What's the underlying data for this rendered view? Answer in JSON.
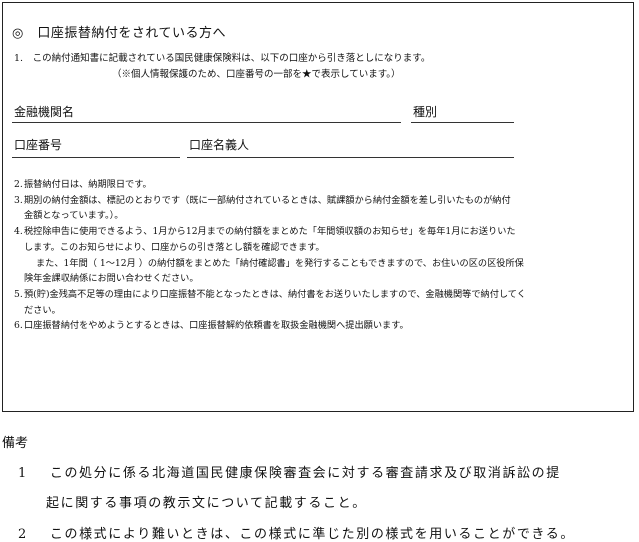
{
  "form": {
    "title": "◎　口座振替納付をされている方へ",
    "item1": "1.　この納付通知書に記載されている国民健康保険料は、以下の口座から引き落としになります。",
    "item1_note": "（※個人情報保護のため、口座番号の一部を★で表示しています。）",
    "fields": {
      "bank_label": "金融機関名",
      "type_label": "種別",
      "account_no_label": "口座番号",
      "holder_label": "口座名義人"
    },
    "notes": [
      {
        "num": "2.",
        "lines": [
          "振替納付日は、納期限日です。"
        ]
      },
      {
        "num": "3.",
        "lines": [
          "期別の納付金額は、標記のとおりです（既に一部納付されているときは、賦課額から納付金額を差し引いたものが納付",
          "金額となっています。）。"
        ]
      },
      {
        "num": "4.",
        "lines": [
          "税控除申告に使用できるよう、1月から12月までの納付額をまとめた「年間領収額のお知らせ」を毎年1月にお送りいた",
          "します。このお知らせにより、口座からの引き落とし額を確認できます。"
        ],
        "indent_lines": [
          "また、1年間（ 1～12月 ）の納付額をまとめた「納付確認書」を発行することもできますので、お住いの区の区役所保",
          "険年金課収納係にお問い合わせください。"
        ]
      },
      {
        "num": "5.",
        "lines": [
          "預(貯)金残高不足等の理由により口座振替不能となったときは、納付書をお送りいたしますので、金融機関等で納付してく",
          "ださい。"
        ]
      },
      {
        "num": "6.",
        "lines": [
          "口座振替納付をやめようとするときは、口座振替解約依頼書を取扱金融機関へ提出願います。"
        ]
      }
    ]
  },
  "remarks": {
    "heading": "備考",
    "items": [
      {
        "num": "1",
        "text": "この処分に係る北海道国民健康保険審査会に対する審査請求及び取消訴訟の提",
        "cont": "起に関する事項の教示文について記載すること。"
      },
      {
        "num": "2",
        "text": "この様式により難いときは、この様式に準じた別の様式を用いることができる。"
      }
    ]
  }
}
